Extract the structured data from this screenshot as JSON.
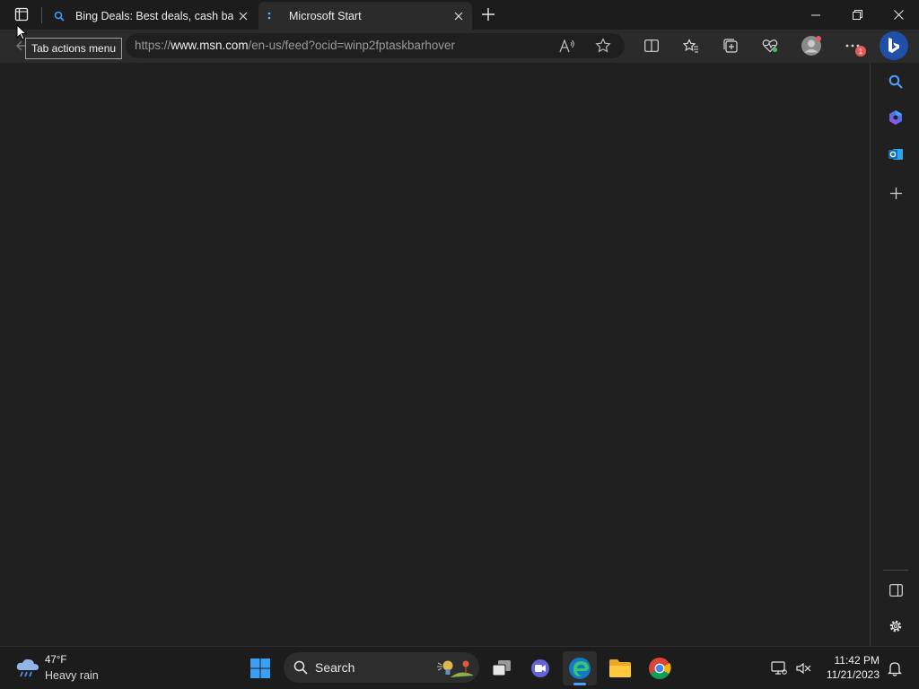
{
  "browser": {
    "tabs": [
      {
        "title": "Bing Deals: Best deals, cash back"
      },
      {
        "title": "Microsoft Start"
      }
    ],
    "address": {
      "prefix": "https://",
      "host": "www.msn.com",
      "path": "/en-us/feed?ocid=winp2fptaskbarhover"
    },
    "tooltip": "Tab actions menu",
    "notification_badge": "1"
  },
  "taskbar": {
    "weather": {
      "temp": "47°F",
      "condition": "Heavy rain"
    },
    "search_label": "Search",
    "clock": {
      "time": "11:42 PM",
      "date": "11/21/2023"
    }
  },
  "colors": {
    "accent_blue": "#0f6cbd",
    "chrome_bg": "#1c1c1c",
    "toolbar_bg": "#2b2b2b",
    "page_bg": "#202020"
  }
}
